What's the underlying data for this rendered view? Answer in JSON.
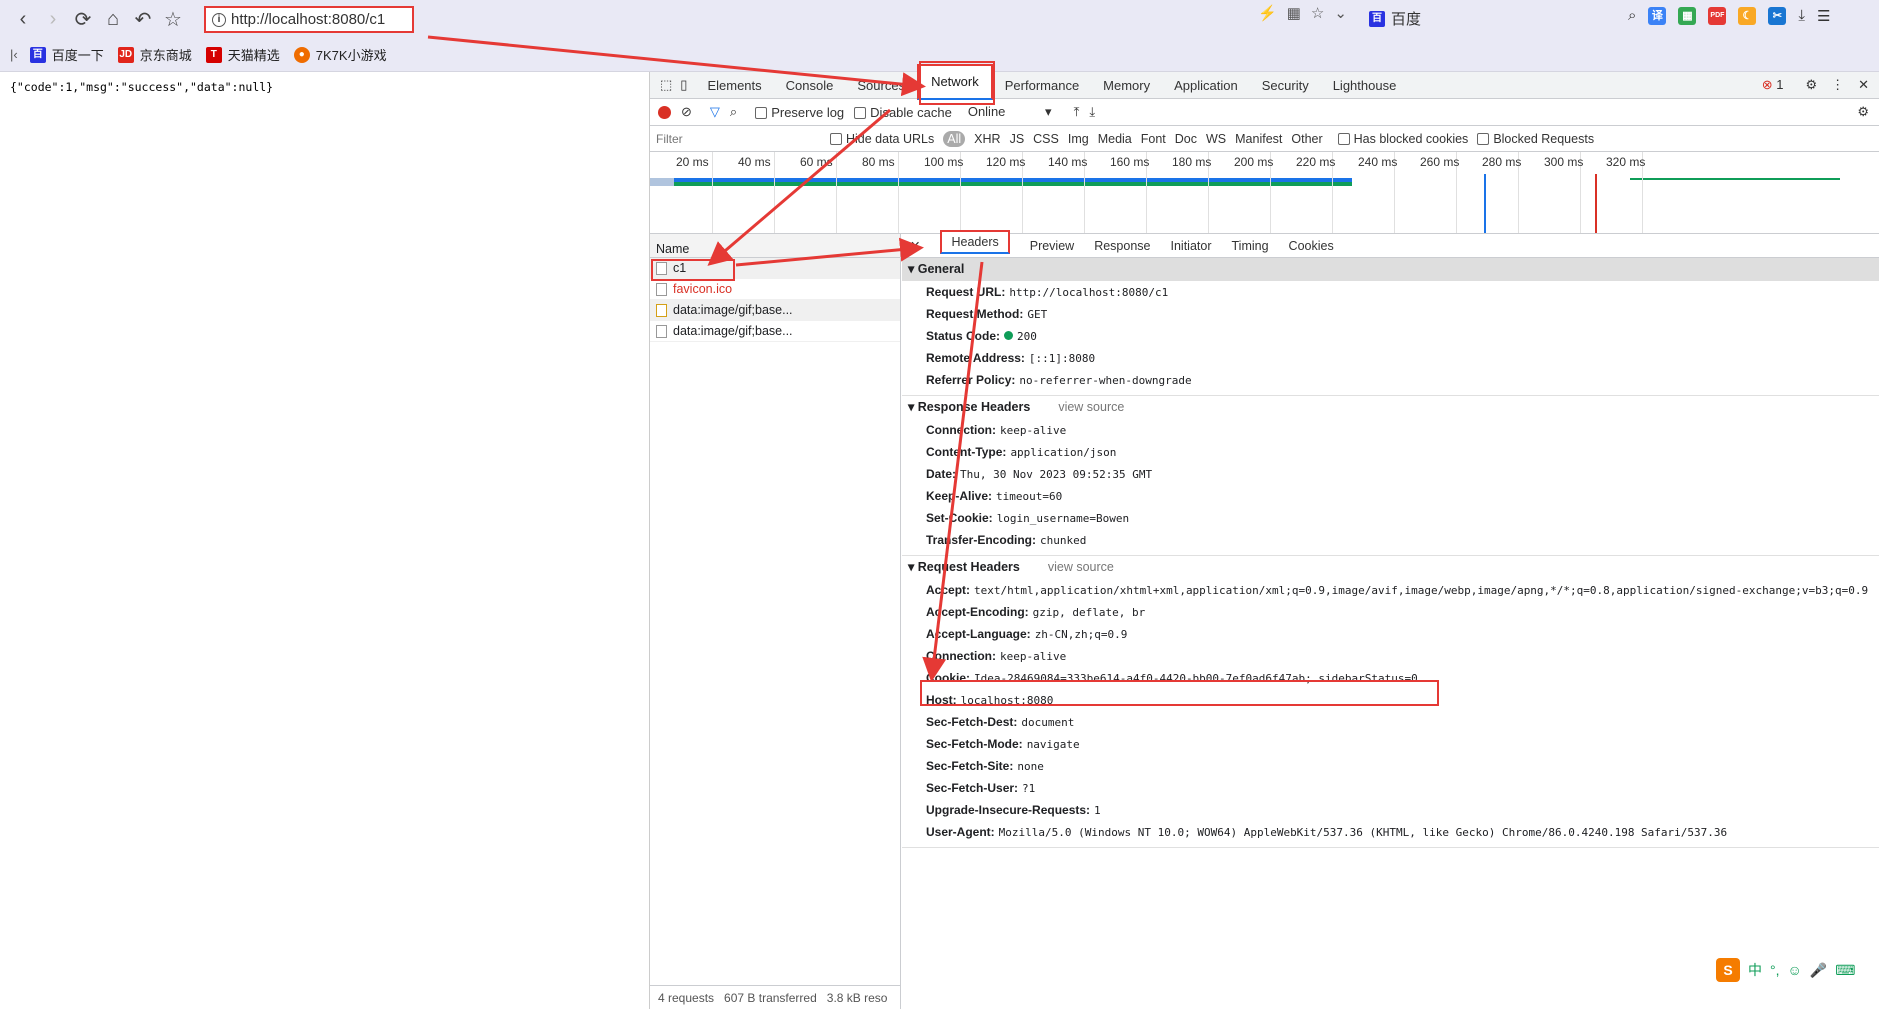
{
  "browser": {
    "url": "http://localhost:8080/c1",
    "search_engine": "百度",
    "bookmarks": [
      "百度一下",
      "京东商城",
      "天猫精选",
      "7K7K小游戏"
    ]
  },
  "page": {
    "json_text": "{\"code\":1,\"msg\":\"success\",\"data\":null}"
  },
  "devtools": {
    "tabs": [
      "Elements",
      "Console",
      "Sources",
      "Network",
      "Performance",
      "Memory",
      "Application",
      "Security",
      "Lighthouse"
    ],
    "active_tab": "Network",
    "error_count": "1",
    "toolbar": {
      "preserve_log": "Preserve log",
      "disable_cache": "Disable cache",
      "throttle": "Online"
    },
    "filter": {
      "placeholder": "Filter",
      "hide_data_urls": "Hide data URLs",
      "types": [
        "All",
        "XHR",
        "JS",
        "CSS",
        "Img",
        "Media",
        "Font",
        "Doc",
        "WS",
        "Manifest",
        "Other"
      ],
      "has_blocked_cookies": "Has blocked cookies",
      "blocked_requests": "Blocked Requests"
    },
    "timeline_ticks": [
      "20 ms",
      "40 ms",
      "60 ms",
      "80 ms",
      "100 ms",
      "120 ms",
      "140 ms",
      "160 ms",
      "180 ms",
      "200 ms",
      "220 ms",
      "240 ms",
      "260 ms",
      "280 ms",
      "300 ms",
      "320 ms"
    ],
    "requests": {
      "header": "Name",
      "rows": [
        "c1",
        "favicon.ico",
        "data:image/gif;base...",
        "data:image/gif;base..."
      ]
    },
    "status": {
      "requests": "4 requests",
      "transferred": "607 B transferred",
      "resources": "3.8 kB reso"
    },
    "detail_tabs": [
      "Headers",
      "Preview",
      "Response",
      "Initiator",
      "Timing",
      "Cookies"
    ],
    "general": {
      "title": "General",
      "rows": [
        {
          "k": "Request URL:",
          "v": "http://localhost:8080/c1"
        },
        {
          "k": "Request Method:",
          "v": "GET"
        },
        {
          "k": "Status Code:",
          "v": "200"
        },
        {
          "k": "Remote Address:",
          "v": "[::1]:8080"
        },
        {
          "k": "Referrer Policy:",
          "v": "no-referrer-when-downgrade"
        }
      ]
    },
    "response_headers": {
      "title": "Response Headers",
      "view_source": "view source",
      "rows": [
        {
          "k": "Connection:",
          "v": "keep-alive"
        },
        {
          "k": "Content-Type:",
          "v": "application/json"
        },
        {
          "k": "Date:",
          "v": "Thu, 30 Nov 2023 09:52:35 GMT"
        },
        {
          "k": "Keep-Alive:",
          "v": "timeout=60"
        },
        {
          "k": "Set-Cookie:",
          "v": "login_username=Bowen"
        },
        {
          "k": "Transfer-Encoding:",
          "v": "chunked"
        }
      ]
    },
    "request_headers": {
      "title": "Request Headers",
      "view_source": "view source",
      "rows": [
        {
          "k": "Accept:",
          "v": "text/html,application/xhtml+xml,application/xml;q=0.9,image/avif,image/webp,image/apng,*/*;q=0.8,application/signed-exchange;v=b3;q=0.9"
        },
        {
          "k": "Accept-Encoding:",
          "v": "gzip, deflate, br"
        },
        {
          "k": "Accept-Language:",
          "v": "zh-CN,zh;q=0.9"
        },
        {
          "k": "Connection:",
          "v": "keep-alive"
        },
        {
          "k": "Cookie:",
          "v": "Idea-28469084=333be614-a4f0-4420-bb00-7ef0ad6f47ab; sidebarStatus=0"
        },
        {
          "k": "Host:",
          "v": "localhost:8080"
        },
        {
          "k": "Sec-Fetch-Dest:",
          "v": "document"
        },
        {
          "k": "Sec-Fetch-Mode:",
          "v": "navigate"
        },
        {
          "k": "Sec-Fetch-Site:",
          "v": "none"
        },
        {
          "k": "Sec-Fetch-User:",
          "v": "?1"
        },
        {
          "k": "Upgrade-Insecure-Requests:",
          "v": "1"
        },
        {
          "k": "User-Agent:",
          "v": "Mozilla/5.0 (Windows NT 10.0; WOW64) AppleWebKit/537.36 (KHTML, like Gecko) Chrome/86.0.4240.198 Safari/537.36"
        }
      ]
    }
  },
  "ime": {
    "label": "中"
  },
  "colors": {
    "annotation": "#e53935",
    "accent": "#1a73e8",
    "status_ok": "#0f9d58"
  }
}
